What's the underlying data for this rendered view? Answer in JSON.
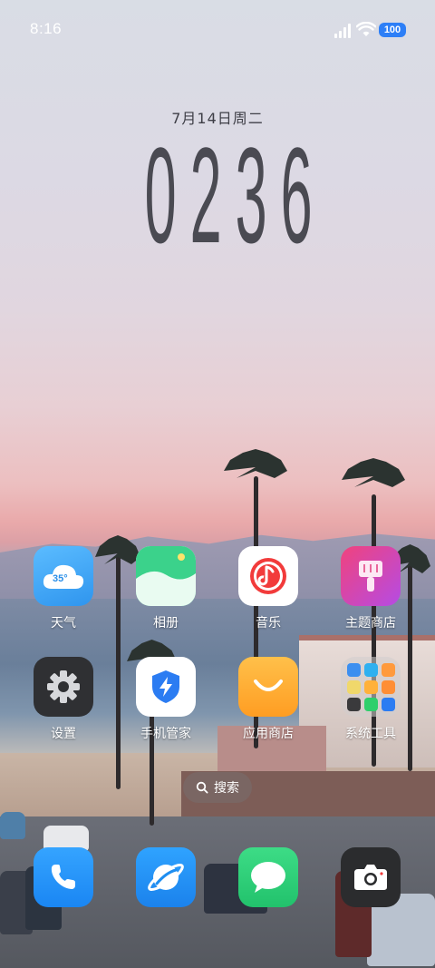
{
  "status_bar": {
    "time": "8:16",
    "battery": "100"
  },
  "clock_widget": {
    "date": "7月14日周二",
    "digits": [
      "0",
      "2",
      "3",
      "6"
    ]
  },
  "apps_row1": [
    {
      "label": "天气",
      "icon": "weather-icon",
      "badge": "35°"
    },
    {
      "label": "相册",
      "icon": "gallery-icon"
    },
    {
      "label": "音乐",
      "icon": "music-icon"
    },
    {
      "label": "主题商店",
      "icon": "themes-icon"
    }
  ],
  "apps_row2": [
    {
      "label": "设置",
      "icon": "gear-icon"
    },
    {
      "label": "手机管家",
      "icon": "security-shield-icon"
    },
    {
      "label": "应用商店",
      "icon": "app-store-icon"
    },
    {
      "label": "系统工具",
      "icon": "folder-icon"
    }
  ],
  "search": {
    "label": "搜索"
  },
  "dock": [
    {
      "icon": "phone-icon"
    },
    {
      "icon": "browser-icon"
    },
    {
      "icon": "messages-icon"
    },
    {
      "icon": "camera-icon"
    }
  ],
  "colors": {
    "weather": "#3aa6f5",
    "gallery": "#2fc77d",
    "music": "#f23b3b",
    "themes": "#d44fbf",
    "settings": "#2f3033",
    "security": "#2b7cf2",
    "app_store": "#ffab2e",
    "phone": "#1e8ff5",
    "browser": "#1f8ef0",
    "messages": "#2ed07a",
    "camera": "#2b2c2e",
    "battery": "#2d7ff7"
  }
}
